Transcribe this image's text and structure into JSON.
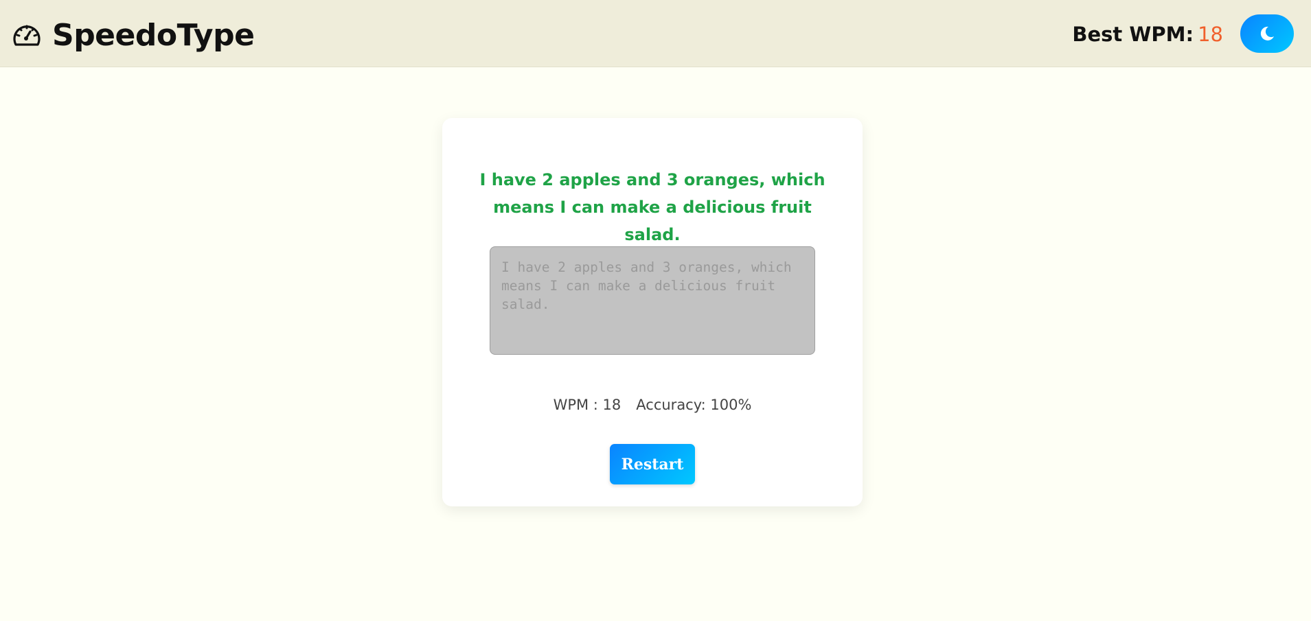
{
  "header": {
    "brand_name": "SpeedoType",
    "logo_icon": "speedometer-icon",
    "best_wpm_label": "Best WPM:",
    "best_wpm_value": "18",
    "theme_toggle_icon": "moon-icon"
  },
  "typing_test": {
    "target_sentence": "I have 2 apples and 3 oranges, which means I can make a delicious fruit salad.",
    "input_placeholder": "I have 2 apples and 3 oranges, which means I can make a delicious fruit salad.",
    "stats": {
      "wpm_text": "WPM : 18",
      "accuracy_text": "Accuracy: 100%"
    },
    "restart_label": "Restart"
  },
  "colors": {
    "header_bg": "#efedda",
    "page_bg": "#fefff5",
    "sentence_green": "#1fa347",
    "best_value_orange": "#f0602c",
    "button_gradient_start": "#0a84ff",
    "button_gradient_end": "#00c8ff"
  }
}
